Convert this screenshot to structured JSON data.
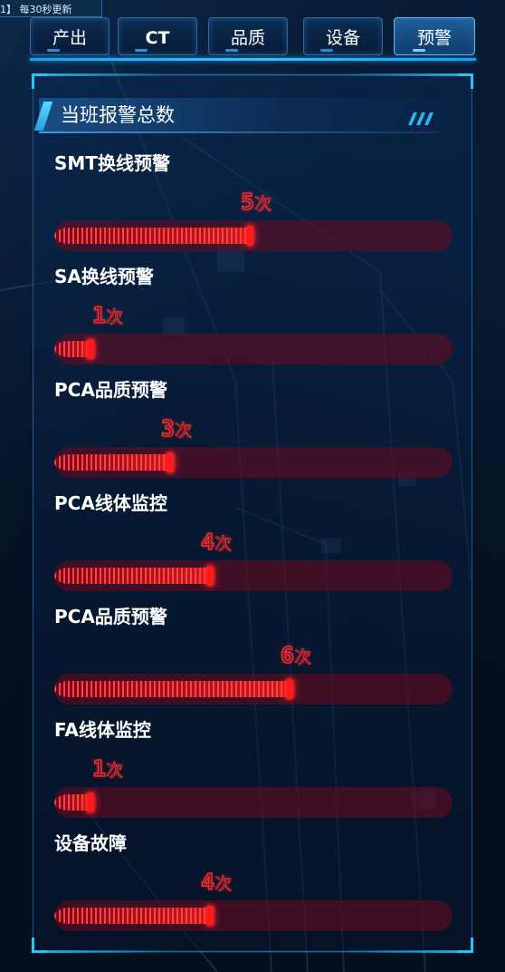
{
  "notice": {
    "text": "1】 每30秒更新"
  },
  "tabs": [
    {
      "label": "产出",
      "active": false
    },
    {
      "label": "CT",
      "active": false
    },
    {
      "label": "品质",
      "active": false
    },
    {
      "label": "设备",
      "active": false
    },
    {
      "label": "预警",
      "active": true
    }
  ],
  "panel": {
    "title": "当班报警总数",
    "items": [
      {
        "label": "SMT换线预警",
        "count": "5",
        "unit": "次",
        "level": 0.5
      },
      {
        "label": "SA换线预警",
        "count": "1",
        "unit": "次",
        "level": 0.1
      },
      {
        "label": "PCA品质预警",
        "count": "3",
        "unit": "次",
        "level": 0.3
      },
      {
        "label": "PCA线体监控",
        "count": "4",
        "unit": "次",
        "level": 0.4
      },
      {
        "label": "PCA品质预警",
        "count": "6",
        "unit": "次",
        "level": 0.6
      },
      {
        "label": "FA线体监控",
        "count": "1",
        "unit": "次",
        "level": 0.1
      },
      {
        "label": "设备故障",
        "count": "4",
        "unit": "次",
        "level": 0.4
      }
    ]
  },
  "colors": {
    "accent": "#22c6ff",
    "alarm": "#ff2a2a",
    "track": "#6e0a1e"
  }
}
